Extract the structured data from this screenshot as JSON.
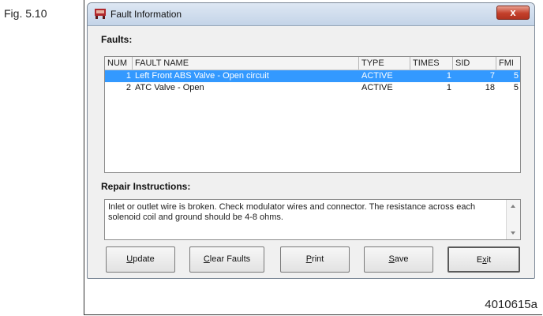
{
  "figure": {
    "label": "Fig. 5.10",
    "reference": "4010615a"
  },
  "window": {
    "title": "Fault Information",
    "close_label": "x"
  },
  "faults": {
    "section_label": "Faults:",
    "columns": [
      "NUM",
      "FAULT NAME",
      "TYPE",
      "TIMES",
      "SID",
      "FMI"
    ],
    "rows": [
      {
        "num": "1",
        "name": "Left Front ABS Valve - Open circuit",
        "type": "ACTIVE",
        "times": "1",
        "sid": "7",
        "fmi": "5",
        "selected": true
      },
      {
        "num": "2",
        "name": "ATC Valve - Open",
        "type": "ACTIVE",
        "times": "1",
        "sid": "18",
        "fmi": "5",
        "selected": false
      }
    ]
  },
  "repair": {
    "section_label": "Repair Instructions:",
    "text": "Inlet or outlet wire is broken.  Check modulator wires and connector.  The resistance across each solenoid coil and ground should be 4-8 ohms."
  },
  "buttons": {
    "update": {
      "mnemonic": "U",
      "rest": "pdate"
    },
    "clear_faults": {
      "mnemonic": "C",
      "rest": "lear Faults"
    },
    "print": {
      "mnemonic": "P",
      "rest": "rint"
    },
    "save": {
      "mnemonic": "S",
      "rest": "ave"
    },
    "exit": {
      "pre": "E",
      "mnemonic": "x",
      "rest": "it"
    }
  }
}
